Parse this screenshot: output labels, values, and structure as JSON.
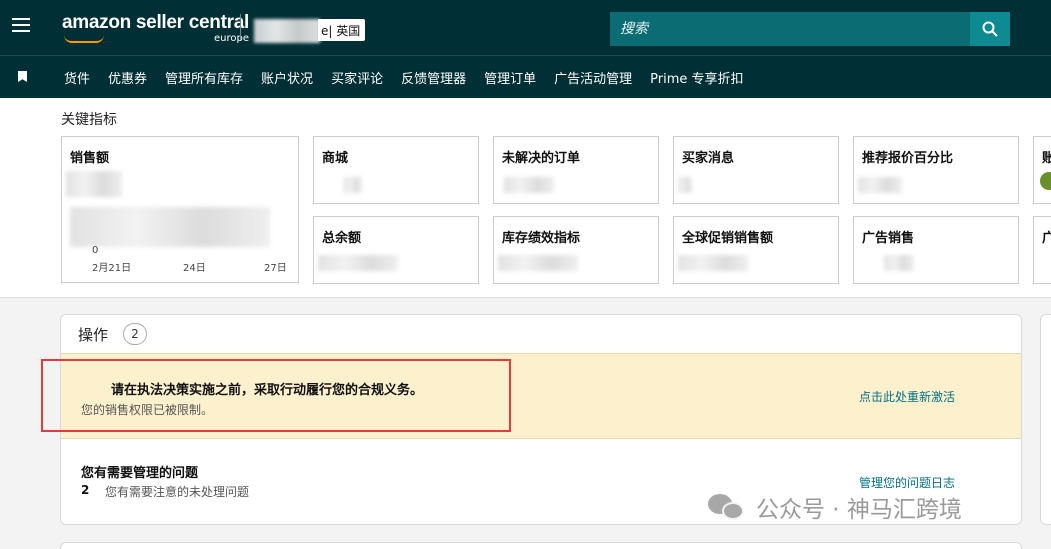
{
  "header": {
    "brand_main": "amazon seller central",
    "brand_region": "europe",
    "store_suffix": "e",
    "marketplace": "| 英国",
    "search_placeholder": "搜索"
  },
  "nav": {
    "items": [
      "货件",
      "优惠券",
      "管理所有库存",
      "账户状况",
      "买家评论",
      "反馈管理器",
      "管理订单",
      "广告活动管理",
      "Prime 专享折扣"
    ]
  },
  "metrics": {
    "title": "关键指标",
    "sales_card": {
      "label": "销售额",
      "axis_zero": "0",
      "ticks": [
        "2月21日",
        "24日",
        "27日"
      ]
    },
    "cards_row1": [
      "商城",
      "未解决的订单",
      "买家消息",
      "推荐报价百分比",
      "账"
    ],
    "cards_row2": [
      "总余额",
      "库存绩效指标",
      "全球促销销售额",
      "广告销售",
      "广"
    ]
  },
  "actions": {
    "title": "操作",
    "count": "2",
    "alert_title": "请在执法决策实施之前，采取行动履行您的合规义务。",
    "alert_sub": "您的销售权限已被限制。",
    "alert_link": "点击此处重新激活",
    "issue_title": "您有需要管理的问题",
    "issue_count": "2",
    "issue_sub": "您有需要注意的未处理问题",
    "issue_link": "管理您的问题日志"
  },
  "watermark": {
    "text": "公众号 · 神马汇跨境"
  },
  "colors": {
    "header_bg": "#002f36",
    "search_bg": "#0b6c73",
    "alert_bg": "#fdf1cd",
    "link": "#007185",
    "highlight": "#e23c3c"
  }
}
